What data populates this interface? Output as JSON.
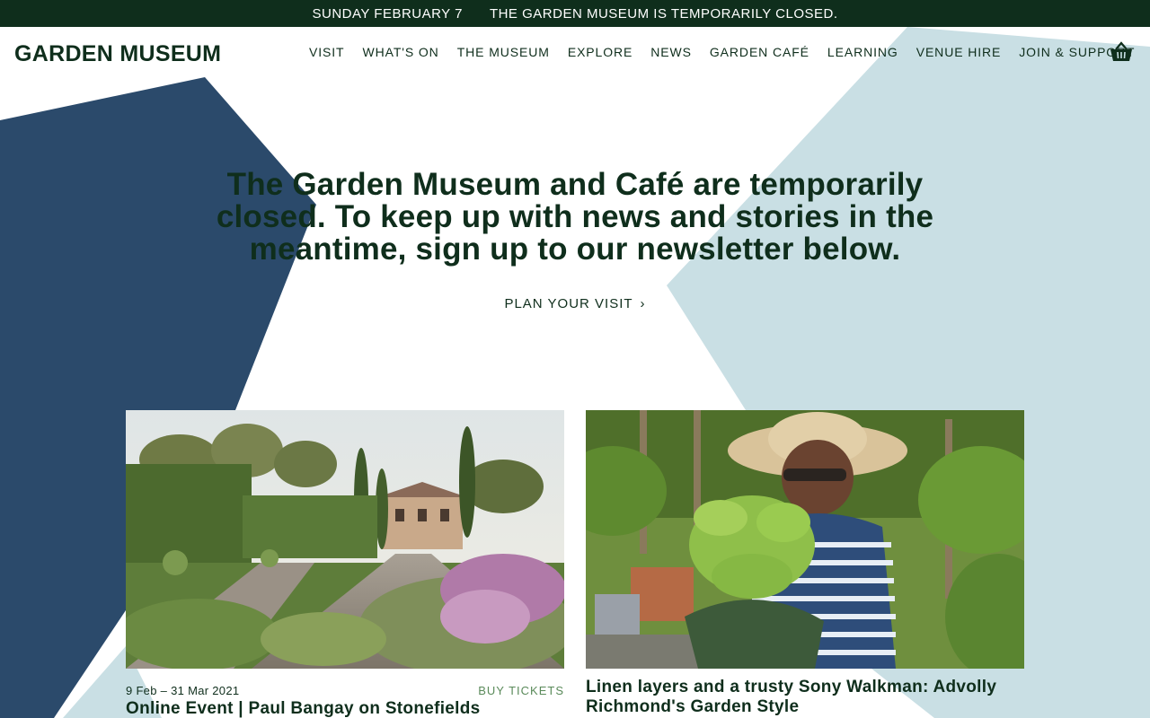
{
  "notice": {
    "date": "SUNDAY FEBRUARY 7",
    "message": "THE GARDEN MUSEUM IS TEMPORARILY CLOSED."
  },
  "header": {
    "logo": "GARDEN MUSEUM",
    "nav": [
      {
        "label": "VISIT"
      },
      {
        "label": "WHAT'S ON"
      },
      {
        "label": "THE MUSEUM"
      },
      {
        "label": "EXPLORE"
      },
      {
        "label": "NEWS"
      },
      {
        "label": "GARDEN CAFÉ"
      },
      {
        "label": "LEARNING"
      },
      {
        "label": "VENUE HIRE"
      },
      {
        "label": "JOIN & SUPPORT"
      }
    ],
    "cart_icon": "basket-icon"
  },
  "hero": {
    "title": "The Garden Museum and Café are temporarily closed. To keep up with news and stories in the meantime, sign up to our newsletter below.",
    "link_label": "PLAN YOUR VISIT",
    "link_icon": "chevron-right-icon"
  },
  "cards": [
    {
      "date": "9 Feb – 31 Mar 2021",
      "action": "BUY TICKETS",
      "title": "Online Event | Paul Bangay on Stonefields"
    },
    {
      "title": "Linen layers and a trusty Sony Walkman: Advolly Richmond's Garden Style"
    }
  ],
  "colors": {
    "brand_dark_green": "#0f2e1c",
    "shape_navy": "#2b4a6b",
    "shape_light_blue": "#c9dfe4",
    "accent_green": "#5a8a5a"
  }
}
